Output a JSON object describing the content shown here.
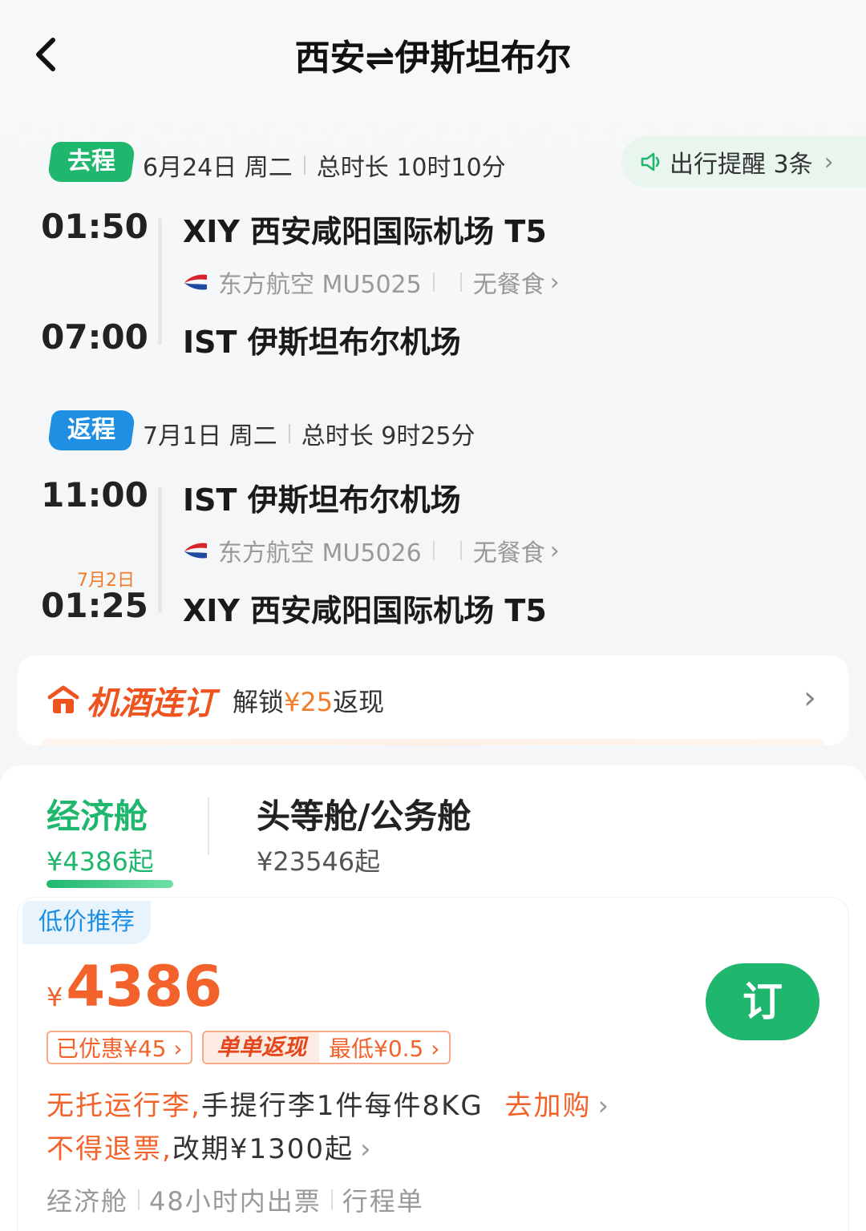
{
  "header": {
    "title": "西安⇌伊斯坦布尔"
  },
  "outbound": {
    "tag": "去程",
    "date": "6月24日 周二",
    "duration": "总时长 10时10分",
    "depart_time": "01:50",
    "depart_airport": "XIY 西安咸阳国际机场 T5",
    "airline": "东方航空 MU5025",
    "meal": "无餐食",
    "arrive_time": "07:00",
    "arrive_airport": "IST 伊斯坦布尔机场"
  },
  "reminder": {
    "label": "出行提醒 3条"
  },
  "return": {
    "tag": "返程",
    "date": "7月1日 周二",
    "duration": "总时长 9时25分",
    "depart_time": "11:00",
    "depart_airport": "IST 伊斯坦布尔机场",
    "airline": "东方航空 MU5026",
    "meal": "无餐食",
    "arrive_date_note": "7月2日",
    "arrive_time": "01:25",
    "arrive_airport": "XIY 西安咸阳国际机场 T5"
  },
  "bundle": {
    "brand": "机酒连订",
    "desc_prefix": "解锁",
    "desc_amount": "¥25",
    "desc_suffix": "返现"
  },
  "cabins": [
    {
      "name": "经济舱",
      "price": "¥4386起"
    },
    {
      "name": "头等舱/公务舱",
      "price": "¥23546起"
    }
  ],
  "fare": {
    "tag": "低价推荐",
    "currency": "¥",
    "price": "4386",
    "book_label": "订",
    "coupon1": "已优惠¥45 ›",
    "coupon2_left": "单单返现",
    "coupon2_right": "最低¥0.5 ›",
    "baggage_warn": "无托运行李,",
    "baggage_info": "手提行李1件每件8KG",
    "baggage_link": "去加购",
    "refund_warn": "不得退票,",
    "refund_info": "改期¥1300起",
    "meta": [
      "经济舱",
      "48小时内出票",
      "行程单"
    ]
  },
  "colors": {
    "green": "#1fb76e",
    "blue": "#1e8fe3",
    "orange": "#f2622a"
  }
}
